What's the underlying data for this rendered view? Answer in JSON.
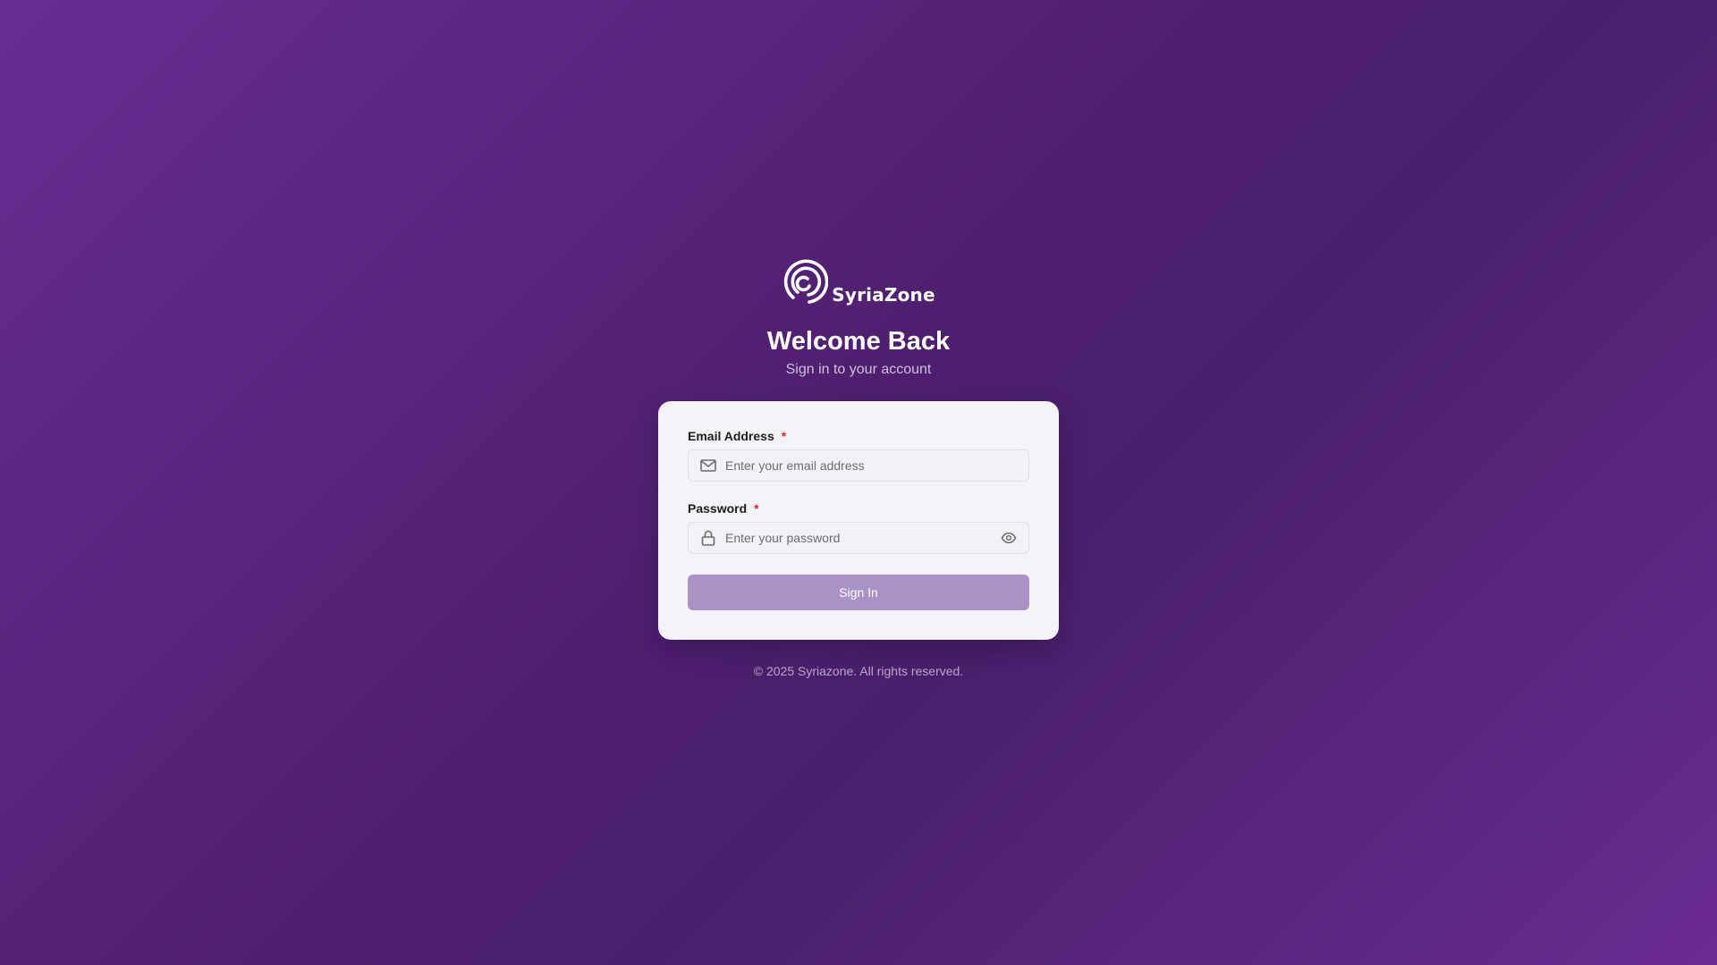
{
  "brand": {
    "name": "SyriaZone",
    "logo_icon": "spiral-logo-icon"
  },
  "header": {
    "title": "Welcome Back",
    "subtitle": "Sign in to your account"
  },
  "form": {
    "email": {
      "label": "Email Address",
      "required_mark": "*",
      "placeholder": "Enter your email address",
      "value": "",
      "icon": "mail-icon"
    },
    "password": {
      "label": "Password",
      "required_mark": "*",
      "placeholder": "Enter your password",
      "value": "",
      "icon": "lock-icon",
      "toggle_icon": "eye-icon"
    },
    "submit_label": "Sign In"
  },
  "footer": {
    "copyright": "© 2025 Syriazone. All rights reserved."
  },
  "colors": {
    "background_start": "#682c93",
    "background_mid": "#4e1f6e",
    "card_background": "#f6f3f8",
    "button_background": "#a892c6",
    "required": "#d8262c"
  }
}
